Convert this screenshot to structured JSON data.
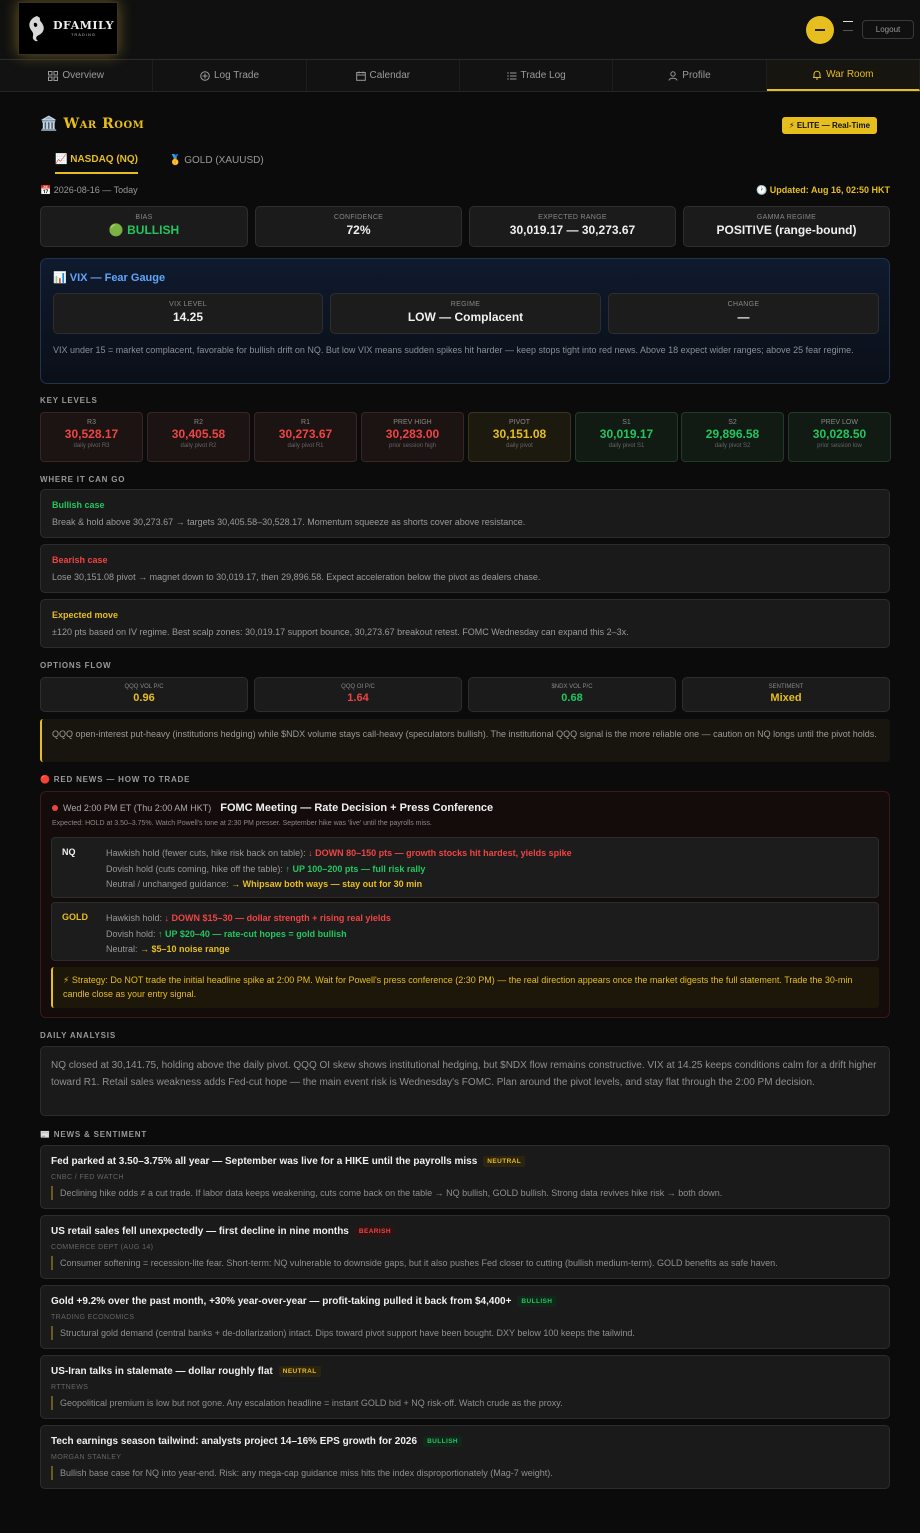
{
  "brand": {
    "name": "DFAMILY",
    "tag": "TRADING"
  },
  "header": {
    "logout_label": "Logout"
  },
  "nav": [
    {
      "label": "Overview",
      "icon": "grid-icon"
    },
    {
      "label": "Log Trade",
      "icon": "plus-circle-icon"
    },
    {
      "label": "Calendar",
      "icon": "calendar-icon"
    },
    {
      "label": "Trade Log",
      "icon": "list-icon"
    },
    {
      "label": "Profile",
      "icon": "user-icon"
    },
    {
      "label": "War Room",
      "icon": "bell-icon"
    }
  ],
  "page": {
    "title": "War Room",
    "title_icon": "🏛️",
    "elite_badge": "⚡ ELITE — Real-Time",
    "tabs": [
      "📈 NASDAQ (NQ)",
      "🥇 GOLD (XAUUSD)"
    ],
    "date": "📅 2026-08-16 — Today",
    "updated": "🕐 Updated: Aug 16, 02:50 HKT"
  },
  "summary": [
    {
      "label": "BIAS",
      "value": "🟢 BULLISH"
    },
    {
      "label": "CONFIDENCE",
      "value": "72%"
    },
    {
      "label": "EXPECTED RANGE",
      "value": "30,019.17 — 30,273.67"
    },
    {
      "label": "GAMMA REGIME",
      "value": "POSITIVE (range-bound)"
    }
  ],
  "vix": {
    "title": "📊 VIX — Fear Gauge",
    "cards": [
      {
        "label": "VIX LEVEL",
        "value": "14.25"
      },
      {
        "label": "REGIME",
        "value": "LOW — Complacent"
      },
      {
        "label": "CHANGE",
        "value": "—"
      }
    ],
    "note": "VIX under 15 = market complacent, favorable for bullish drift on NQ. But low VIX means sudden spikes hit harder — keep stops tight into red news. Above 18 expect wider ranges; above 25 fear regime."
  },
  "key_levels_label": "KEY LEVELS",
  "levels": [
    {
      "label": "R3",
      "value": "30,528.17",
      "sub": "daily pivot R3",
      "tone": "red"
    },
    {
      "label": "R2",
      "value": "30,405.58",
      "sub": "daily pivot R2",
      "tone": "red"
    },
    {
      "label": "R1",
      "value": "30,273.67",
      "sub": "daily pivot R1",
      "tone": "red"
    },
    {
      "label": "PREV HIGH",
      "value": "30,283.00",
      "sub": "prior session high",
      "tone": "red"
    },
    {
      "label": "PIVOT",
      "value": "30,151.08",
      "sub": "daily pivot",
      "tone": "gold"
    },
    {
      "label": "S1",
      "value": "30,019.17",
      "sub": "daily pivot S1",
      "tone": "green"
    },
    {
      "label": "S2",
      "value": "29,896.58",
      "sub": "daily pivot S2",
      "tone": "green"
    },
    {
      "label": "PREV LOW",
      "value": "30,028.50",
      "sub": "prior session low",
      "tone": "green"
    }
  ],
  "where_label": "WHERE IT CAN GO",
  "cases": [
    {
      "title": "Bullish case",
      "body": "Break & hold above 30,273.67 → targets 30,405.58–30,528.17. Momentum squeeze as shorts cover above resistance."
    },
    {
      "title": "Bearish case",
      "body": "Lose 30,151.08 pivot → magnet down to 30,019.17, then 29,896.58. Expect acceleration below the pivot as dealers chase."
    },
    {
      "title": "Expected move",
      "body": "±120 pts based on IV regime. Best scalp zones: 30,019.17 support bounce, 30,273.67 breakout retest. FOMC Wednesday can expand this 2–3x."
    }
  ],
  "options_label": "OPTIONS FLOW",
  "options": [
    {
      "label": "QQQ VOL P/C",
      "value": "0.96"
    },
    {
      "label": "QQQ OI P/C",
      "value": "1.64"
    },
    {
      "label": "$NDX VOL P/C",
      "value": "0.68"
    },
    {
      "label": "SENTIMENT",
      "value": "Mixed"
    }
  ],
  "options_note": "QQQ open-interest put-heavy (institutions hedging) while $NDX volume stays call-heavy (speculators bullish). The institutional QQQ signal is the more reliable one — caution on NQ longs until the pivot holds.",
  "red_news": {
    "label": "🔴 RED NEWS — HOW TO TRADE",
    "time": "Wed 2:00 PM ET (Thu 2:00 AM HKT)",
    "event": "FOMC Meeting — Rate Decision + Press Conference",
    "expected": "Expected: HOLD at 3.50–3.75%. Watch Powell's tone at 2:30 PM presser. September hike was 'live' until the payrolls miss.",
    "nq": {
      "asset": "NQ",
      "rows": [
        {
          "cond": "Hawkish hold (fewer cuts, hike risk back on table):",
          "out": "↓ DOWN 80–150 pts — growth stocks hit hardest, yields spike"
        },
        {
          "cond": "Dovish hold (cuts coming, hike off the table):",
          "out": "↑ UP 100–200 pts — full risk rally"
        },
        {
          "cond": "Neutral / unchanged guidance:",
          "out": "→ Whipsaw both ways — stay out for 30 min"
        }
      ]
    },
    "gold": {
      "asset": "GOLD",
      "rows": [
        {
          "cond": "Hawkish hold:",
          "out": "↓ DOWN $15–30 — dollar strength + rising real yields"
        },
        {
          "cond": "Dovish hold:",
          "out": "↑ UP $20–40 — rate-cut hopes = gold bullish"
        },
        {
          "cond": "Neutral:",
          "out": "→ $5–10 noise range"
        }
      ]
    },
    "strategy": "⚡ Strategy: Do NOT trade the initial headline spike at 2:00 PM. Wait for Powell's press conference (2:30 PM) — the real direction appears once the market digests the full statement. Trade the 30-min candle close as your entry signal."
  },
  "analysis_label": "DAILY ANALYSIS",
  "analysis": "NQ closed at 30,141.75, holding above the daily pivot. QQQ OI skew shows institutional hedging, but $NDX flow remains constructive. VIX at 14.25 keeps conditions calm for a drift higher toward R1. Retail sales weakness adds Fed-cut hope — the main event risk is Wednesday's FOMC. Plan around the pivot levels, and stay flat through the 2:00 PM decision.",
  "news_label": "📰 NEWS & SENTIMENT",
  "news": [
    {
      "headline": "Fed parked at 3.50–3.75% all year — September was live for a HIKE until the payrolls miss",
      "badge": "NEUTRAL",
      "tone": "neutral",
      "source": "CNBC / FED WATCH",
      "take": "Declining hike odds ≠ a cut trade. If labor data keeps weakening, cuts come back on the table → NQ bullish, GOLD bullish. Strong data revives hike risk → both down."
    },
    {
      "headline": "US retail sales fell unexpectedly — first decline in nine months",
      "badge": "BEARISH",
      "tone": "bearish",
      "source": "COMMERCE DEPT (AUG 14)",
      "take": "Consumer softening = recession-lite fear. Short-term: NQ vulnerable to downside gaps, but it also pushes Fed closer to cutting (bullish medium-term). GOLD benefits as safe haven."
    },
    {
      "headline": "Gold +9.2% over the past month, +30% year-over-year — profit-taking pulled it back from $4,400+",
      "badge": "BULLISH",
      "tone": "bullish",
      "source": "TRADING ECONOMICS",
      "take": "Structural gold demand (central banks + de-dollarization) intact. Dips toward pivot support have been bought. DXY below 100 keeps the tailwind."
    },
    {
      "headline": "US-Iran talks in stalemate — dollar roughly flat",
      "badge": "NEUTRAL",
      "tone": "neutral",
      "source": "RTTNEWS",
      "take": "Geopolitical premium is low but not gone. Any escalation headline = instant GOLD bid + NQ risk-off. Watch crude as the proxy."
    },
    {
      "headline": "Tech earnings season tailwind: analysts project 14–16% EPS growth for 2026",
      "badge": "BULLISH",
      "tone": "bullish",
      "source": "MORGAN STANLEY",
      "take": "Bullish base case for NQ into year-end. Risk: any mega-cap guidance miss hits the index disproportionately (Mag-7 weight)."
    }
  ]
}
